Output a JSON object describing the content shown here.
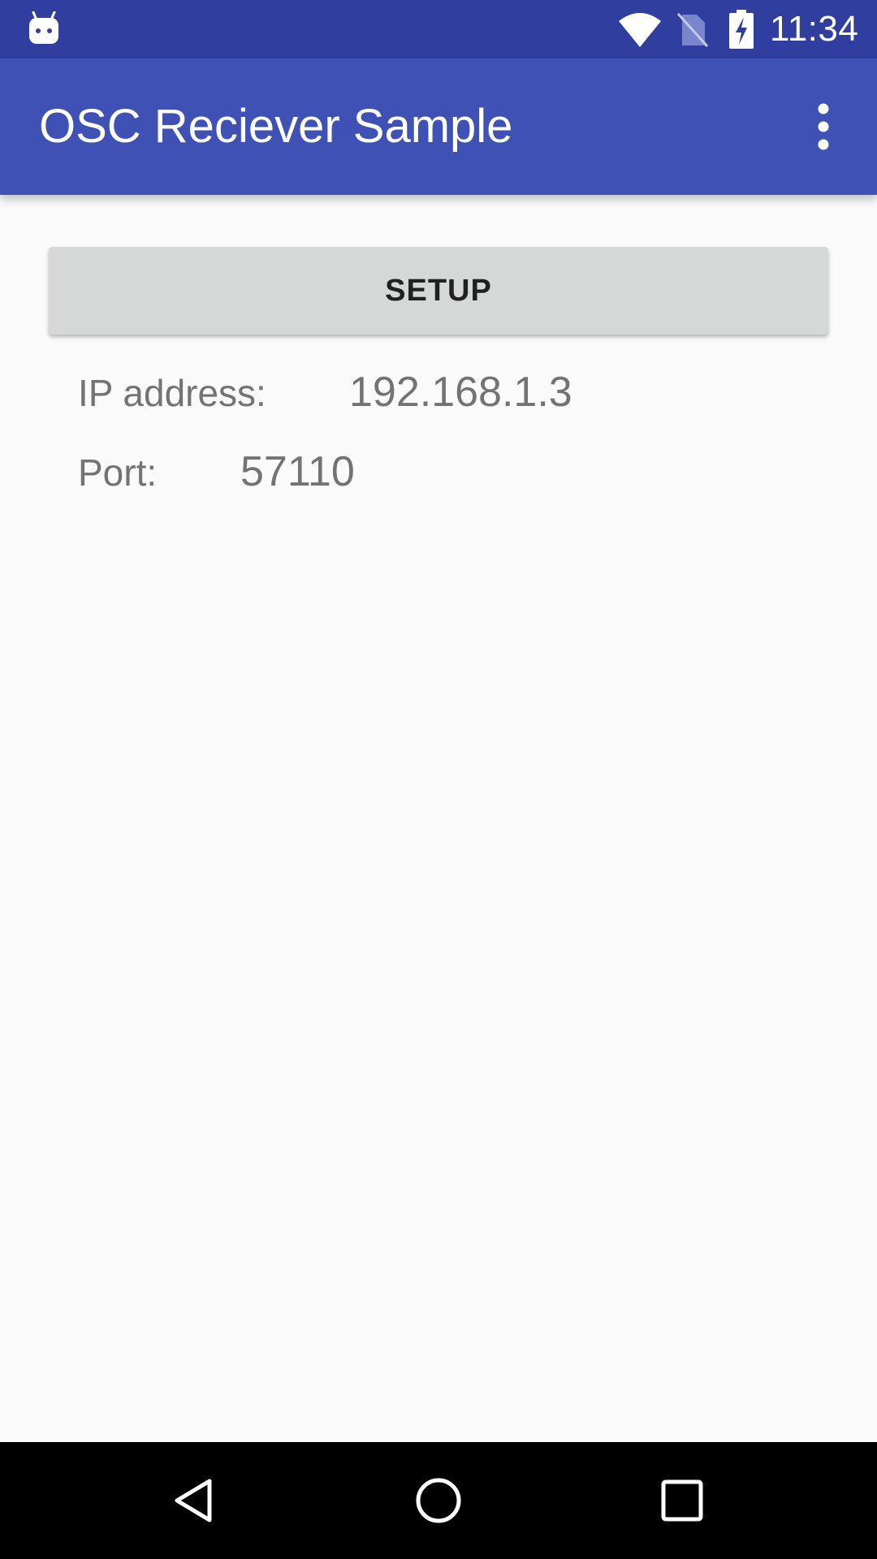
{
  "status_bar": {
    "time": "11:34",
    "icons": [
      "android-robot-icon",
      "wifi-icon",
      "no-sim-icon",
      "battery-charging-icon"
    ]
  },
  "app_bar": {
    "title": "OSC Reciever Sample",
    "menu_icon": "more-vert-icon"
  },
  "main": {
    "setup_button_label": "SETUP",
    "ip_label": "IP address:",
    "ip_value": "192.168.1.3",
    "port_label": "Port:",
    "port_value": "57110"
  },
  "nav_bar": {
    "icons": [
      "back-icon",
      "home-icon",
      "recents-icon"
    ]
  },
  "colors": {
    "status_bar": "#303f9f",
    "app_bar": "#3f51b5",
    "background": "#fafafa",
    "button": "#d6d7d7",
    "secondary_text": "#737373"
  }
}
